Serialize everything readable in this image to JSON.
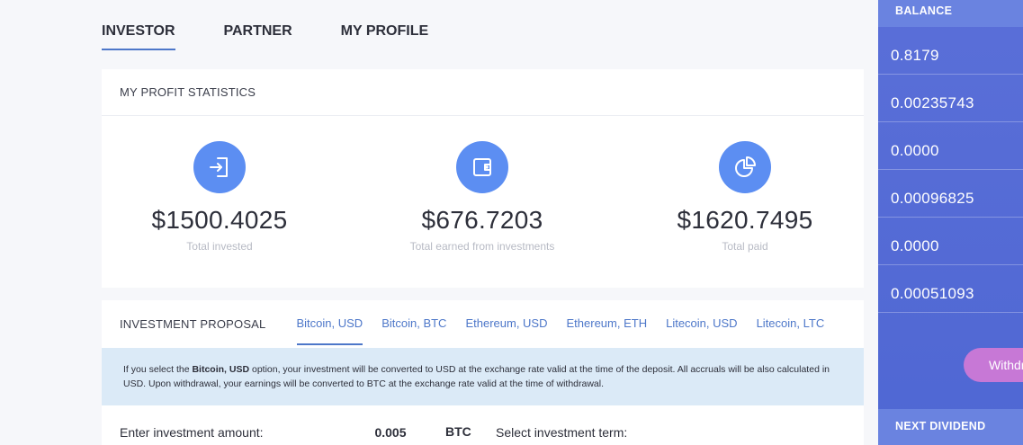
{
  "nav": {
    "tabs": [
      {
        "label": "INVESTOR",
        "active": true
      },
      {
        "label": "PARTNER",
        "active": false
      },
      {
        "label": "MY PROFILE",
        "active": false
      }
    ]
  },
  "stats": {
    "title": "MY PROFIT STATISTICS",
    "items": [
      {
        "icon": "login-icon",
        "amount": "$1500.4025",
        "caption": "Total invested"
      },
      {
        "icon": "wallet-icon",
        "amount": "$676.7203",
        "caption": "Total earned from investments"
      },
      {
        "icon": "pie-chart-icon",
        "amount": "$1620.7495",
        "caption": "Total paid"
      }
    ]
  },
  "proposal": {
    "title": "INVESTMENT PROPOSAL",
    "tabs": [
      {
        "label": "Bitcoin, USD",
        "active": true
      },
      {
        "label": "Bitcoin, BTC",
        "active": false
      },
      {
        "label": "Ethereum, USD",
        "active": false
      },
      {
        "label": "Ethereum, ETH",
        "active": false
      },
      {
        "label": "Litecoin, USD",
        "active": false
      },
      {
        "label": "Litecoin, LTC",
        "active": false
      }
    ],
    "notice_before": "If you select the ",
    "notice_bold": "Bitcoin, USD",
    "notice_after": " option, your investment will be converted to USD at the exchange rate valid at the time of the deposit. All accruals will be also calculated in USD. Upon withdrawal, your earnings will be converted to BTC at the exchange rate valid at the time of withdrawal.",
    "amount_label": "Enter investment amount:",
    "amount_value": "0.005",
    "currency": "BTC",
    "term_label": "Select investment term:"
  },
  "sidebar": {
    "balance_title": "BALANCE",
    "balances": [
      "0.8179",
      "0.00235743",
      "0.0000",
      "0.00096825",
      "0.0000",
      "0.00051093"
    ],
    "withdraw_label": "Withdraw",
    "next_dividend_title": "NEXT DIVIDEND"
  },
  "colors": {
    "accent": "#4d77c9",
    "icon_circle": "#5c8ef2",
    "sidebar": "#5268d4",
    "withdraw_button": "#c778d6",
    "notice_bg": "#dbeaf7"
  }
}
